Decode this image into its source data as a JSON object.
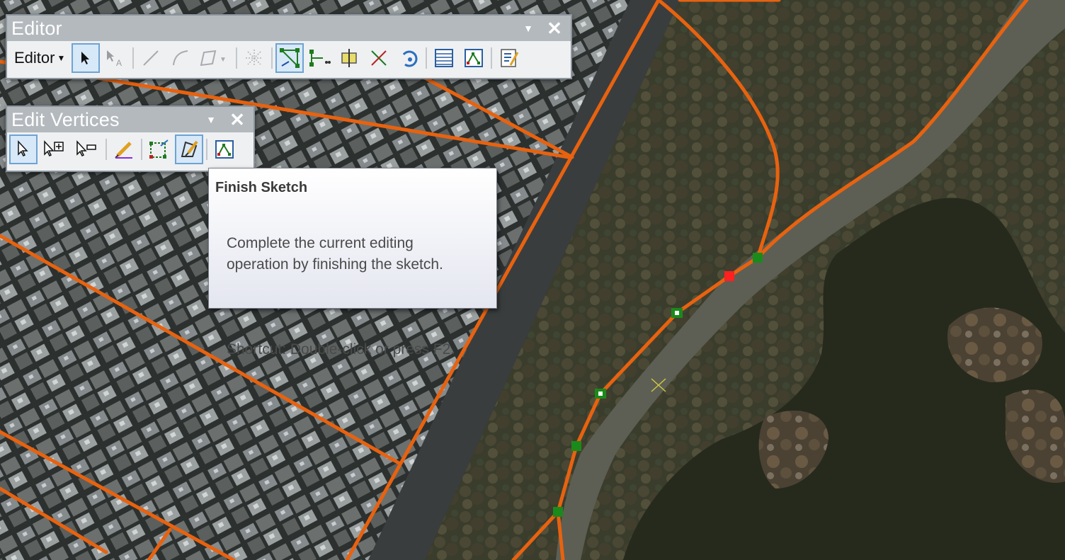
{
  "editor_toolbar": {
    "title": "Editor",
    "menu_label": "Editor",
    "tools": [
      "edit-tool",
      "edit-annotation-tool",
      "straight-segment",
      "endpoint-arc",
      "trace",
      "cut-polygons",
      "edit-vertices",
      "reshape-feature",
      "split-tool",
      "rotate-tool",
      "undo",
      "attributes",
      "sketch-properties",
      "editing-options"
    ]
  },
  "vertices_toolbar": {
    "title": "Edit Vertices",
    "tools": [
      "modify-sketch-vertices",
      "add-vertex",
      "delete-vertex",
      "continue-feature",
      "change-segment",
      "finish-sketch",
      "sketch-properties"
    ]
  },
  "tooltip": {
    "title": "Finish Sketch",
    "description": "Complete the current editing\noperation by finishing the sketch.",
    "shortcut": "Shortcut: Double-click or press F2."
  },
  "colors": {
    "road_line": "#e8620f",
    "vertex_green": "#1a8a1a",
    "vertex_red": "#ff2020",
    "active_border": "#6ea3d3"
  }
}
